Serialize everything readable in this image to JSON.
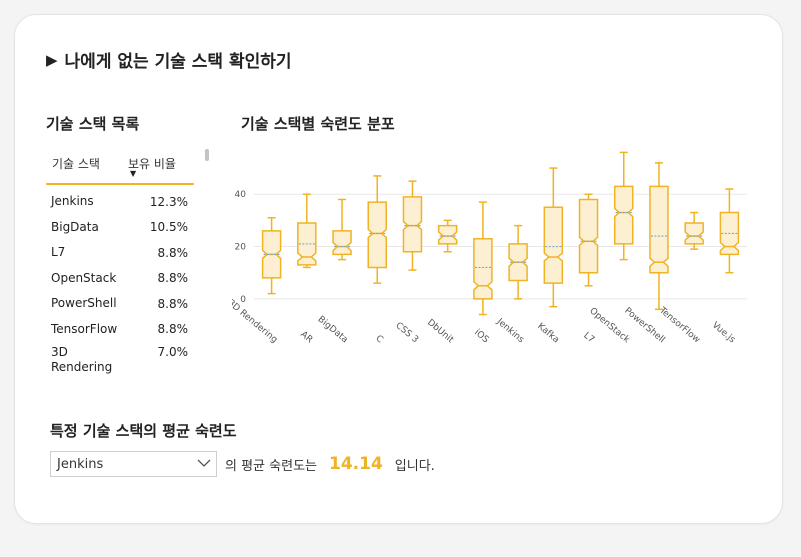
{
  "page": {
    "title": "나에게 없는 기술 스택 확인하기"
  },
  "list": {
    "title": "기술 스택 목록",
    "col_name": "기술 스택",
    "col_ratio": "보유 비율",
    "rows": [
      {
        "name": "Jenkins",
        "ratio": "12.3%"
      },
      {
        "name": "BigData",
        "ratio": "10.5%"
      },
      {
        "name": "L7",
        "ratio": "8.8%"
      },
      {
        "name": "OpenStack",
        "ratio": "8.8%"
      },
      {
        "name": "PowerShell",
        "ratio": "8.8%"
      },
      {
        "name": "TensorFlow",
        "ratio": "8.8%"
      },
      {
        "name": "3D Rendering",
        "ratio": "7.0%"
      }
    ]
  },
  "chart_title": "기술 스택별 숙련도 분포",
  "chart_data": {
    "type": "box",
    "title": "기술 스택별 숙련도 분포",
    "categories": [
      "3D Rendering",
      "AR",
      "BigData",
      "C",
      "CSS 3",
      "DbUnit",
      "iOS",
      "Jenkins",
      "Kafka",
      "L7",
      "OpenStack",
      "PowerShell",
      "TensorFlow",
      "Vue.js"
    ],
    "y_ticks": [
      0,
      20,
      40
    ],
    "ylim": [
      -10,
      55
    ],
    "series": [
      {
        "min": 2,
        "q1": 8,
        "median": 17,
        "q3": 26,
        "max": 31,
        "mean": 17
      },
      {
        "min": 12,
        "q1": 13,
        "median": 16,
        "q3": 29,
        "max": 40,
        "mean": 21
      },
      {
        "min": 15,
        "q1": 17,
        "median": 20,
        "q3": 26,
        "max": 38,
        "mean": 20
      },
      {
        "min": 6,
        "q1": 12,
        "median": 25,
        "q3": 37,
        "max": 47,
        "mean": 25
      },
      {
        "min": 11,
        "q1": 18,
        "median": 28,
        "q3": 39,
        "max": 45,
        "mean": 28
      },
      {
        "min": 18,
        "q1": 21,
        "median": 24,
        "q3": 28,
        "max": 30,
        "mean": 24
      },
      {
        "min": -6,
        "q1": 0,
        "median": 5,
        "q3": 23,
        "max": 37,
        "mean": 12
      },
      {
        "min": 0,
        "q1": 7,
        "median": 14,
        "q3": 21,
        "max": 28,
        "mean": 14
      },
      {
        "min": -3,
        "q1": 6,
        "median": 16,
        "q3": 35,
        "max": 50,
        "mean": 20
      },
      {
        "min": 5,
        "q1": 10,
        "median": 22,
        "q3": 38,
        "max": 40,
        "mean": 22
      },
      {
        "min": 15,
        "q1": 21,
        "median": 33,
        "q3": 43,
        "max": 56,
        "mean": 33
      },
      {
        "min": -4,
        "q1": 10,
        "median": 14,
        "q3": 43,
        "max": 52,
        "mean": 24
      },
      {
        "min": 19,
        "q1": 21,
        "median": 24,
        "q3": 29,
        "max": 33,
        "mean": 24
      },
      {
        "min": 10,
        "q1": 17,
        "median": 20,
        "q3": 33,
        "max": 42,
        "mean": 25
      }
    ],
    "colors": {
      "box_stroke": "#f0b323",
      "box_fill": "#fdf0d2",
      "mean_line": "#7ea6c9",
      "grid": "#e8e8e8"
    }
  },
  "avg": {
    "title": "특정 기술 스택의 평균 숙련도",
    "selected": "Jenkins",
    "text_before": "의 평균 숙련도는",
    "value": "14.14",
    "text_after": "입니다."
  }
}
